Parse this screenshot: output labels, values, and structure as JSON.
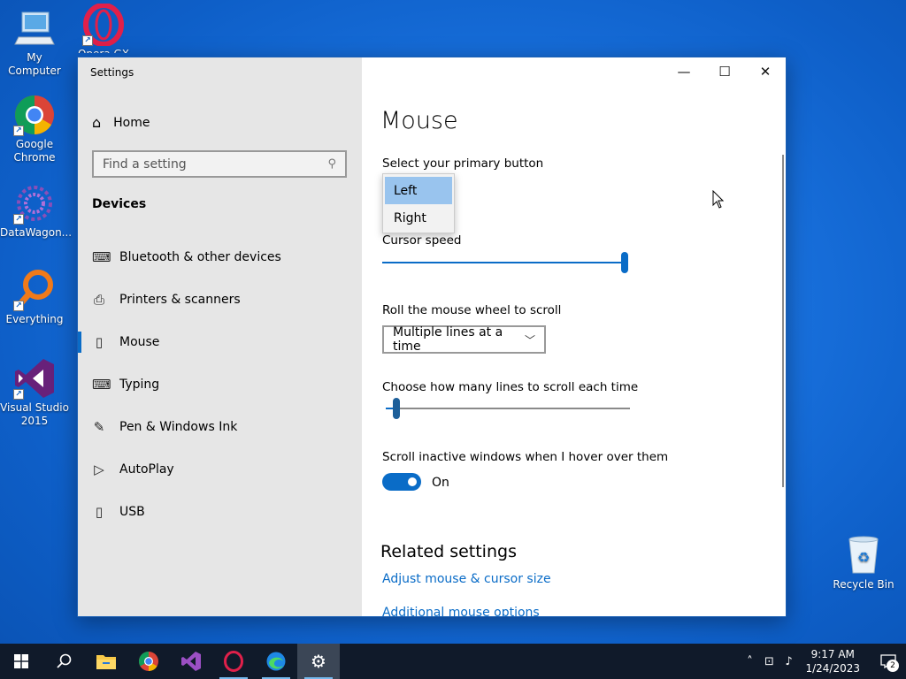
{
  "desktop": {
    "icons": [
      {
        "label": "My Computer",
        "icon": "computer-icon"
      },
      {
        "label": "Opera GX",
        "icon": "opera-gx-icon"
      },
      {
        "label": "Google Chrome",
        "icon": "chrome-icon"
      },
      {
        "label": "DataWagon...",
        "icon": "datawagon-icon"
      },
      {
        "label": "Everything",
        "icon": "everything-search-icon"
      },
      {
        "label": "Visual Studio 2015",
        "icon": "visual-studio-icon"
      }
    ],
    "recycle_bin": {
      "label": "Recycle Bin",
      "icon": "recycle-bin-icon"
    }
  },
  "window": {
    "title": "Settings",
    "controls": {
      "minimize": "—",
      "maximize": "☐",
      "close": "✕"
    }
  },
  "sidebar": {
    "home_label": "Home",
    "search_placeholder": "Find a setting",
    "section": "Devices",
    "items": [
      {
        "label": "Bluetooth & other devices",
        "icon": "bluetooth-devices-icon",
        "glyph": "⌨"
      },
      {
        "label": "Printers & scanners",
        "icon": "printer-icon",
        "glyph": "⎙"
      },
      {
        "label": "Mouse",
        "icon": "mouse-icon",
        "glyph": "▯",
        "active": true
      },
      {
        "label": "Typing",
        "icon": "keyboard-icon",
        "glyph": "⌨"
      },
      {
        "label": "Pen & Windows Ink",
        "icon": "pen-icon",
        "glyph": "✎"
      },
      {
        "label": "AutoPlay",
        "icon": "autoplay-icon",
        "glyph": "▷"
      },
      {
        "label": "USB",
        "icon": "usb-icon",
        "glyph": "▯"
      }
    ]
  },
  "main": {
    "title": "Mouse",
    "primary_button_label": "Select your primary button",
    "primary_button_options": [
      "Left",
      "Right"
    ],
    "primary_button_highlighted": "Left",
    "cursor_speed_label": "Cursor speed",
    "cursor_speed_value": 1.0,
    "scroll_label": "Roll the mouse wheel to scroll",
    "scroll_value": "Multiple lines at a time",
    "lines_label": "Choose how many lines to scroll each time",
    "lines_value": 0.03,
    "inactive_label": "Scroll inactive windows when I hover over them",
    "inactive_state": "On",
    "related_title": "Related settings",
    "links": [
      "Adjust mouse & cursor size",
      "Additional mouse options"
    ]
  },
  "taskbar": {
    "apps": [
      "start-icon",
      "search-icon",
      "file-explorer-icon",
      "chrome-icon",
      "visual-studio-icon",
      "opera-gx-icon",
      "edge-icon",
      "settings-icon"
    ],
    "time": "9:17 AM",
    "date": "1/24/2023",
    "notifications_count": "2"
  },
  "colors": {
    "accent": "#0a6cc7",
    "sidebar_bg": "#e6e6e6",
    "taskbar_bg": "#101a2a"
  }
}
